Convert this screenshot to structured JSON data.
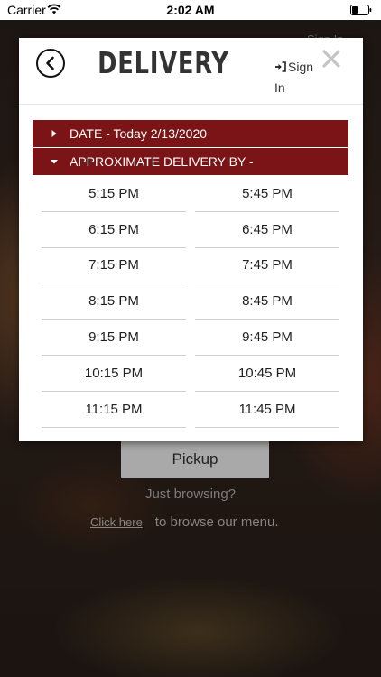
{
  "status_bar": {
    "carrier": "Carrier",
    "time": "2:02 AM"
  },
  "background": {
    "signin_text": "Sign In",
    "pickup_label": "Pickup",
    "browsing_question": "Just browsing?",
    "click_here": "Click here",
    "browse_menu": "to browse our menu."
  },
  "modal": {
    "title": "DELIVERY",
    "signin_label": "Sign In",
    "close_label": "✕"
  },
  "sections": {
    "date_label": "DATE - Today 2/13/2020",
    "delivery_label": "APPROXIMATE DELIVERY BY -"
  },
  "times": [
    [
      "5:15 PM",
      "5:45 PM"
    ],
    [
      "6:15 PM",
      "6:45 PM"
    ],
    [
      "7:15 PM",
      "7:45 PM"
    ],
    [
      "8:15 PM",
      "8:45 PM"
    ],
    [
      "9:15 PM",
      "9:45 PM"
    ],
    [
      "10:15 PM",
      "10:45 PM"
    ],
    [
      "11:15 PM",
      "11:45 PM"
    ]
  ],
  "colors": {
    "accent": "#7a1416"
  }
}
